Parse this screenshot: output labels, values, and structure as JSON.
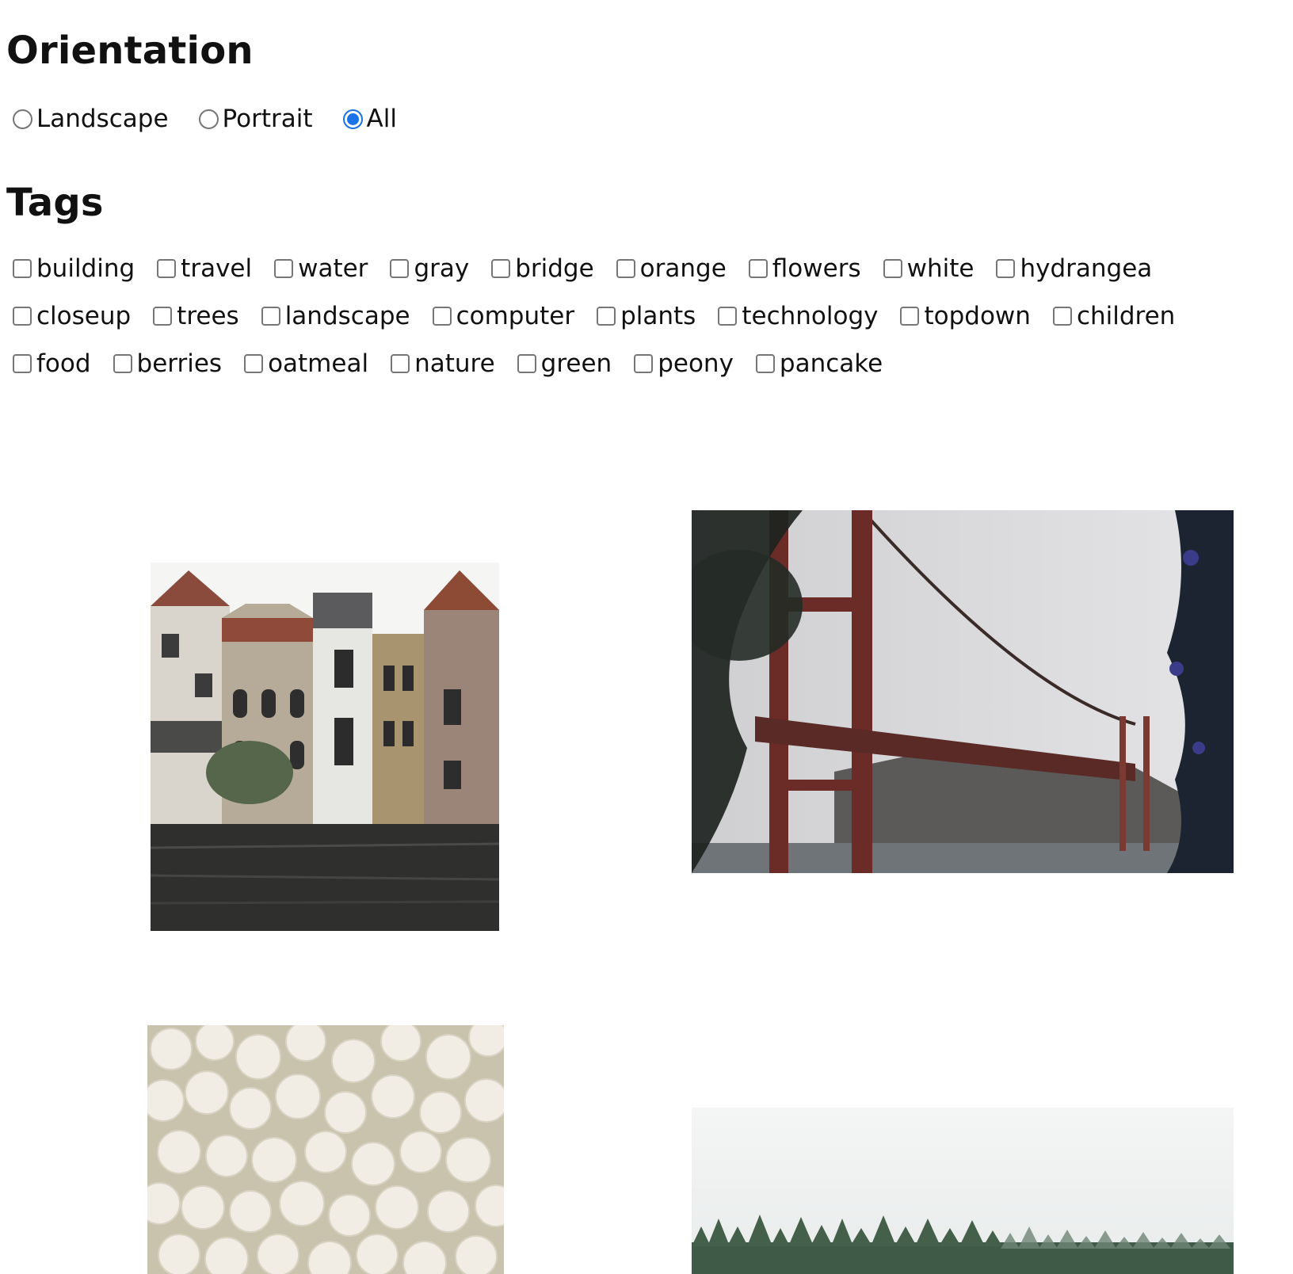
{
  "orientation": {
    "heading": "Orientation",
    "options": [
      {
        "label": "Landscape",
        "checked": false
      },
      {
        "label": "Portrait",
        "checked": false
      },
      {
        "label": "All",
        "checked": true
      }
    ]
  },
  "tags": {
    "heading": "Tags",
    "rows": [
      [
        "building",
        "travel",
        "water",
        "gray",
        "bridge",
        "orange",
        "flowers",
        "white",
        "hydrangea"
      ],
      [
        "closeup",
        "trees",
        "landscape",
        "computer",
        "plants",
        "technology",
        "topdown",
        "children"
      ],
      [
        "food",
        "berries",
        "oatmeal",
        "nature",
        "green",
        "peony",
        "pancake"
      ]
    ]
  },
  "gallery": {
    "images": [
      {
        "subject": "canal-houses"
      },
      {
        "subject": "foggy-bridge"
      },
      {
        "subject": "white-hydrangea"
      },
      {
        "subject": "misty-forest"
      }
    ]
  },
  "colors": {
    "accent": "#1a73e8",
    "checkbox_border": "#767676"
  }
}
